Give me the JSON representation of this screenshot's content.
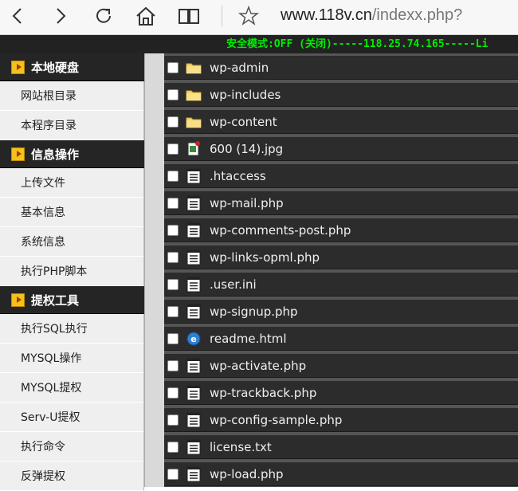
{
  "browser": {
    "icons": [
      "back-arrow-icon",
      "forward-arrow-icon",
      "reload-icon",
      "home-icon",
      "reading-view-icon",
      "favorite-star-icon"
    ],
    "url_host": "www.118v.cn",
    "url_path": "/indexx.php?"
  },
  "status": {
    "text": "安全模式:OFF (关闭)-----118.25.74.165-----Li"
  },
  "sidebar": {
    "sections": [
      {
        "title": "本地硬盘",
        "items": [
          "网站根目录",
          "本程序目录"
        ]
      },
      {
        "title": "信息操作",
        "items": [
          "上传文件",
          "基本信息",
          "系统信息",
          "执行PHP脚本"
        ]
      },
      {
        "title": "提权工具",
        "items": [
          "执行SQL执行",
          "MYSQL操作",
          "MYSQL提权",
          "Serv-U提权",
          "执行命令",
          "反弹提权"
        ]
      }
    ]
  },
  "files": [
    {
      "name": "wp-admin",
      "icon": "folder-icon"
    },
    {
      "name": "wp-includes",
      "icon": "folder-icon"
    },
    {
      "name": "wp-content",
      "icon": "folder-icon"
    },
    {
      "name": "600 (14).jpg",
      "icon": "image-file-icon"
    },
    {
      "name": ".htaccess",
      "icon": "text-file-icon"
    },
    {
      "name": "wp-mail.php",
      "icon": "text-file-icon"
    },
    {
      "name": "wp-comments-post.php",
      "icon": "text-file-icon"
    },
    {
      "name": "wp-links-opml.php",
      "icon": "text-file-icon"
    },
    {
      "name": ".user.ini",
      "icon": "text-file-icon"
    },
    {
      "name": "wp-signup.php",
      "icon": "text-file-icon"
    },
    {
      "name": "readme.html",
      "icon": "html-file-icon"
    },
    {
      "name": "wp-activate.php",
      "icon": "text-file-icon"
    },
    {
      "name": "wp-trackback.php",
      "icon": "text-file-icon"
    },
    {
      "name": "wp-config-sample.php",
      "icon": "text-file-icon"
    },
    {
      "name": "license.txt",
      "icon": "text-file-icon"
    },
    {
      "name": "wp-load.php",
      "icon": "text-file-icon"
    }
  ]
}
